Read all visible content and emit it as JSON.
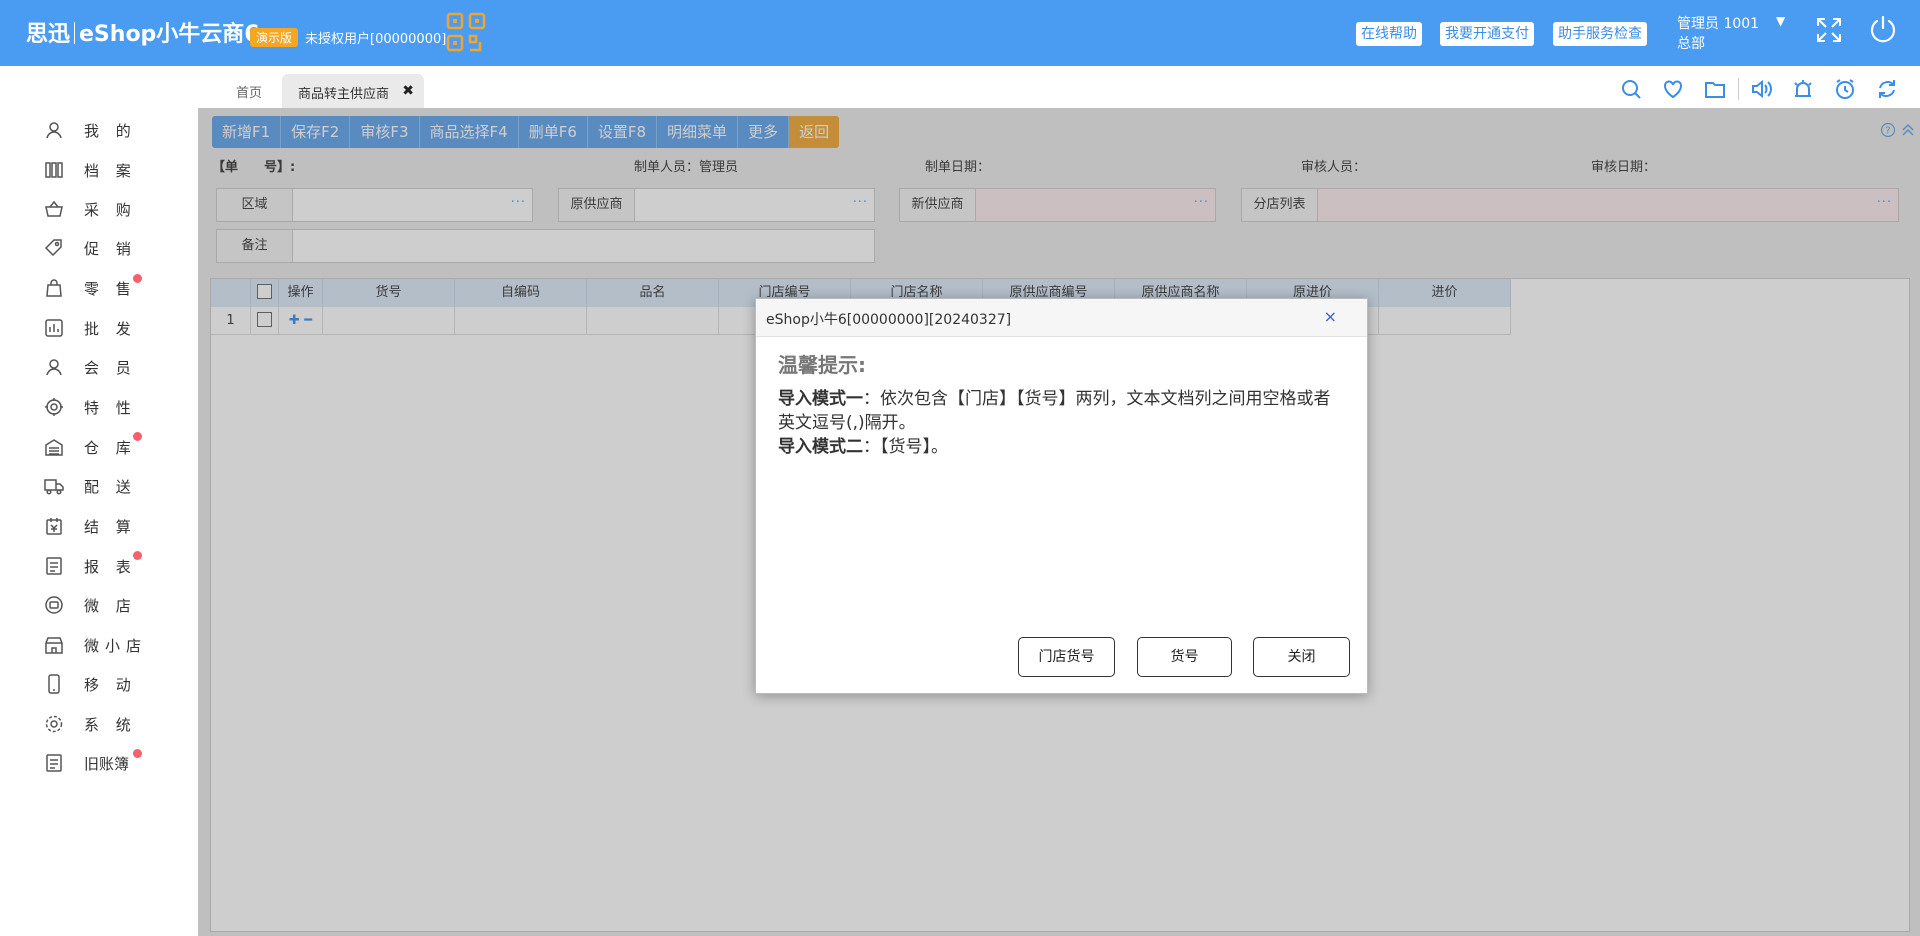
{
  "header": {
    "brand_cn": "思迅",
    "brand_product": "eShop小牛云商6",
    "demo_badge": "演示版",
    "unauthorized_user": "未授权用户[00000000]",
    "help_button": "在线帮助",
    "pay_button": "我要开通支付",
    "service_button": "助手服务检查",
    "user_name": "管理员 1001",
    "user_branch": "总部",
    "user_caret": "▼"
  },
  "sidebar": {
    "items": [
      {
        "label": "我 的",
        "icon": "user-icon",
        "dot": false
      },
      {
        "label": "档 案",
        "icon": "archive-icon",
        "dot": false
      },
      {
        "label": "采 购",
        "icon": "basket-icon",
        "dot": false
      },
      {
        "label": "促 销",
        "icon": "tag-icon",
        "dot": false
      },
      {
        "label": "零 售",
        "icon": "bag-icon",
        "dot": true
      },
      {
        "label": "批 发",
        "icon": "wholesale-icon",
        "dot": false
      },
      {
        "label": "会 员",
        "icon": "member-icon",
        "dot": false
      },
      {
        "label": "特 性",
        "icon": "feature-icon",
        "dot": false
      },
      {
        "label": "仓 库",
        "icon": "warehouse-icon",
        "dot": true
      },
      {
        "label": "配 送",
        "icon": "truck-icon",
        "dot": false
      },
      {
        "label": "结 算",
        "icon": "settlement-icon",
        "dot": false
      },
      {
        "label": "报 表",
        "icon": "report-icon",
        "dot": true
      },
      {
        "label": "微 店",
        "icon": "microshop-icon",
        "dot": false
      },
      {
        "label": "微小店",
        "icon": "store-icon",
        "dot": false
      },
      {
        "label": "移 动",
        "icon": "mobile-icon",
        "dot": false
      },
      {
        "label": "系 统",
        "icon": "gear-icon",
        "dot": false
      },
      {
        "label": "旧账簿",
        "icon": "ledger-icon",
        "dot": true
      }
    ]
  },
  "tabs": {
    "home": "首页",
    "active": "商品转主供应商",
    "close": "✖"
  },
  "toolbar": {
    "buttons": [
      "新增F1",
      "保存F2",
      "审核F3",
      "商品选择F4",
      "删单F6",
      "设置F8",
      "明细菜单",
      "更多"
    ],
    "back": "返回"
  },
  "form": {
    "order_no_label": "【单　　号】:",
    "maker_label": "制单人员：管理员",
    "make_date_label": "制单日期：",
    "auditor_label": "审核人员：",
    "audit_date_label": "审核日期：",
    "fields": {
      "region": "区域",
      "orig_supplier": "原供应商",
      "new_supplier": "新供应商",
      "branch_list": "分店列表",
      "remark": "备注"
    },
    "dots": "···"
  },
  "grid": {
    "headers": [
      "操作",
      "货号",
      "自编码",
      "品名",
      "门店编号",
      "门店名称",
      "原供应商编号",
      "原供应商名称",
      "原进价",
      "进价"
    ],
    "row_number": "1"
  },
  "modal": {
    "title": "eShop小牛6[00000000][20240327]",
    "close": "×",
    "heading": "温馨提示:",
    "mode1_label": "导入模式一",
    "mode1_text": "：依次包含【门店】【货号】两列，文本文档列之间用空格或者英文逗号(,)隔开。",
    "mode2_label": "导入模式二",
    "mode2_text": "：【货号】。",
    "btn_store_code": "门店货号",
    "btn_code": "货号",
    "btn_close": "关闭"
  }
}
